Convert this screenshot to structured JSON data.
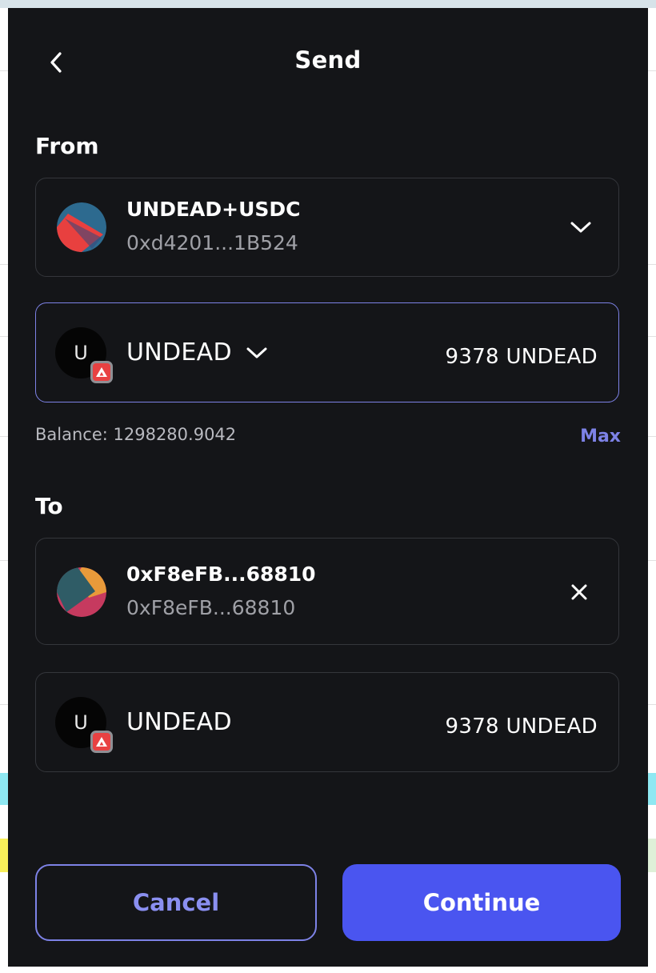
{
  "header": {
    "title": "Send",
    "back_icon": "chevron-left-icon"
  },
  "from": {
    "label": "From",
    "account": {
      "name": "UNDEAD+USDC",
      "address": "0xd4201...1B524"
    },
    "token": {
      "symbol_initial": "U",
      "name": "UNDEAD",
      "amount": "9378 UNDEAD"
    },
    "balance": "Balance: 1298280.9042",
    "max_label": "Max"
  },
  "to": {
    "label": "To",
    "recipient": {
      "name": "0xF8eFB...68810",
      "address": "0xF8eFB...68810"
    },
    "token": {
      "symbol_initial": "U",
      "name": "UNDEAD",
      "amount": "9378 UNDEAD"
    }
  },
  "actions": {
    "cancel_label": "Cancel",
    "continue_label": "Continue"
  },
  "colors": {
    "modal_bg": "#141518",
    "accent": "#7d82e6",
    "primary_button": "#4a55f0",
    "chain_badge": "#e84142"
  }
}
